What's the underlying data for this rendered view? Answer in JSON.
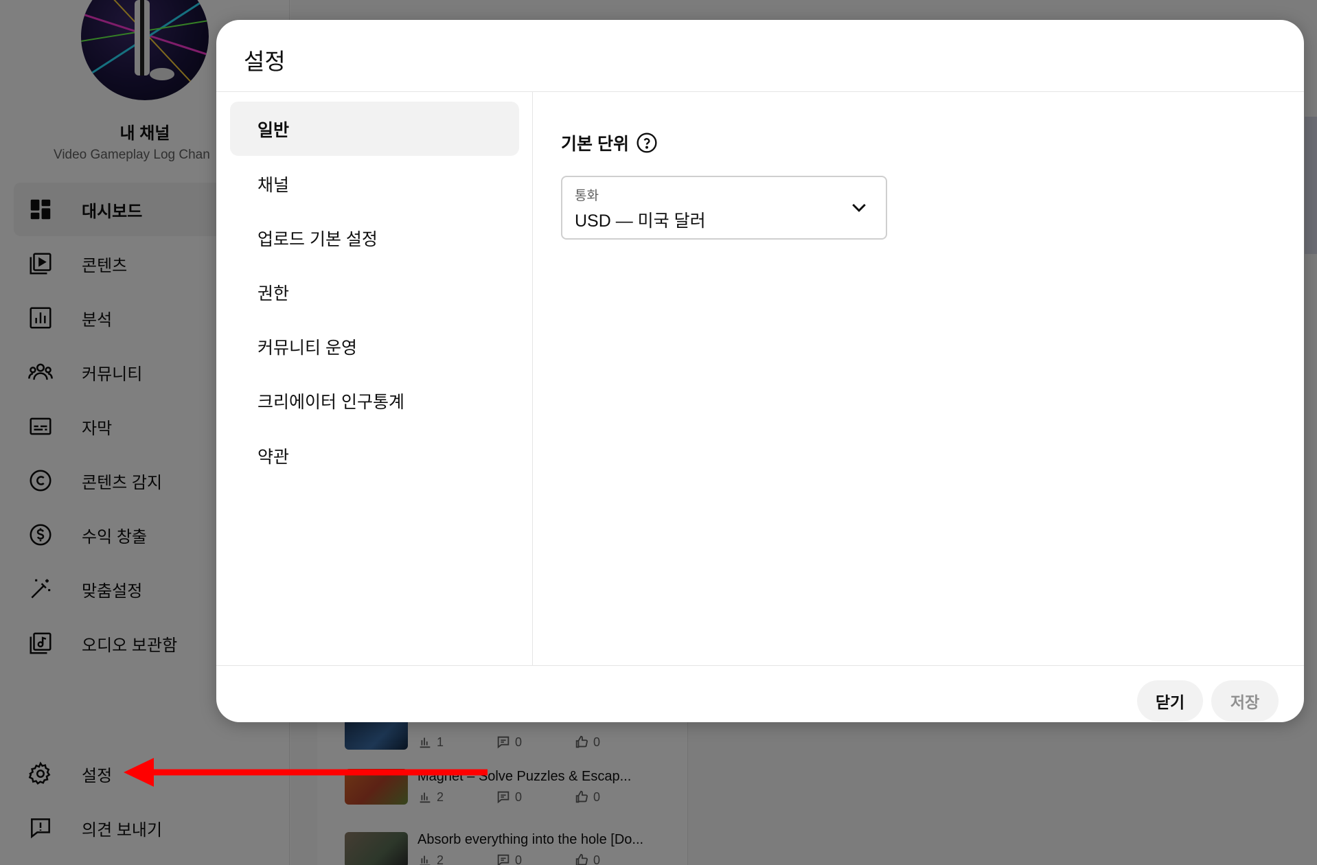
{
  "channel": {
    "name": "내 채널",
    "subtitle": "Video Gameplay Log Chan"
  },
  "sidebar": {
    "items": [
      {
        "label": "대시보드",
        "icon": "dashboard-icon",
        "active": true
      },
      {
        "label": "콘텐츠",
        "icon": "content-icon"
      },
      {
        "label": "분석",
        "icon": "analytics-icon"
      },
      {
        "label": "커뮤니티",
        "icon": "community-icon"
      },
      {
        "label": "자막",
        "icon": "subtitles-icon"
      },
      {
        "label": "콘텐츠 감지",
        "icon": "copyright-icon"
      },
      {
        "label": "수익 창출",
        "icon": "monetization-icon"
      },
      {
        "label": "맞춤설정",
        "icon": "customization-icon"
      },
      {
        "label": "오디오 보관함",
        "icon": "audio-library-icon"
      }
    ],
    "bottom": [
      {
        "label": "설정",
        "icon": "gear-icon"
      },
      {
        "label": "의견 보내기",
        "icon": "feedback-icon"
      }
    ]
  },
  "background": {
    "videos": [
      {
        "title": "",
        "views": "1",
        "comments": "0",
        "likes": "0"
      },
      {
        "title": "Magnet – Solve Puzzles & Escap...",
        "views": "2",
        "comments": "0",
        "likes": "0"
      },
      {
        "title": "Absorb everything into the hole [Do...",
        "views": "2",
        "comments": "0",
        "likes": "0"
      }
    ]
  },
  "dialog": {
    "title": "설정",
    "tabs": [
      {
        "label": "일반",
        "active": true
      },
      {
        "label": "채널"
      },
      {
        "label": "업로드 기본 설정"
      },
      {
        "label": "권한"
      },
      {
        "label": "커뮤니티 운영"
      },
      {
        "label": "크리에이터 인구통계"
      },
      {
        "label": "약관"
      }
    ],
    "general": {
      "section_label": "기본 단위",
      "currency_label": "통화",
      "currency_value": "USD — 미국 달러"
    },
    "buttons": {
      "close": "닫기",
      "save": "저장"
    }
  },
  "colors": {
    "scrim": "#00000080",
    "annotation_arrow": "#ff0000",
    "active_bg": "#f2f2f2"
  }
}
